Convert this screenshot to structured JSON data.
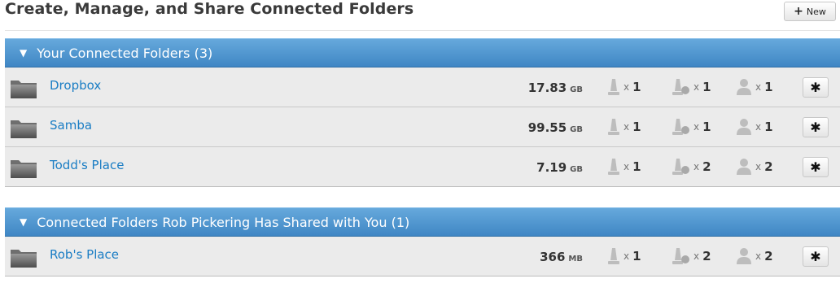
{
  "page": {
    "title": "Create, Manage, and Share Connected Folders",
    "new_button": {
      "icon": "plus-icon",
      "label": "New"
    }
  },
  "sections": [
    {
      "title": "Your Connected Folders (3)",
      "folders": [
        {
          "name": "Dropbox",
          "size": "17.83",
          "unit": "GB",
          "stat1_x": "x",
          "stat1": "1",
          "stat2_x": "x",
          "stat2": "1",
          "stat3_x": "x",
          "stat3": "1"
        },
        {
          "name": "Samba",
          "size": "99.55",
          "unit": "GB",
          "stat1_x": "x",
          "stat1": "1",
          "stat2_x": "x",
          "stat2": "1",
          "stat3_x": "x",
          "stat3": "1"
        },
        {
          "name": "Todd's Place",
          "size": "7.19",
          "unit": "GB",
          "stat1_x": "x",
          "stat1": "1",
          "stat2_x": "x",
          "stat2": "2",
          "stat3_x": "x",
          "stat3": "2"
        }
      ]
    },
    {
      "title": "Connected Folders Rob Pickering Has Shared with You (1)",
      "folders": [
        {
          "name": "Rob's Place",
          "size": "366",
          "unit": "MB",
          "stat1_x": "x",
          "stat1": "1",
          "stat2_x": "x",
          "stat2": "2",
          "stat3_x": "x",
          "stat3": "2"
        }
      ]
    }
  ],
  "colors": {
    "section_bar": "#4d92cc",
    "link": "#1a7dc4",
    "row_bg": "#ebebeb"
  },
  "icons": {
    "folder": "folder-icon",
    "stat1": "device-icon",
    "stat2": "device-sync-icon",
    "stat3": "user-icon",
    "settings": "gear-icon"
  }
}
